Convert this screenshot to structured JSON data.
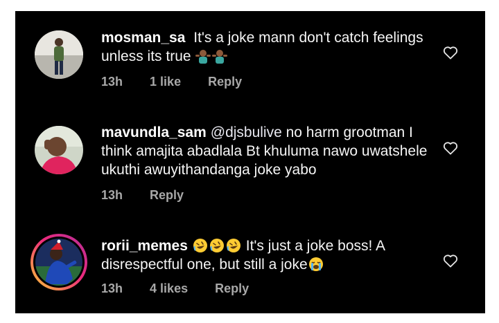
{
  "comments": [
    {
      "username": "mosman_sa",
      "text_1": " It's a joke mann don't catch feelings unless its true ",
      "time": "13h",
      "likes": "1 like",
      "reply": "Reply",
      "emoji": "person-shrugging-emoji"
    },
    {
      "username": "mavundla_sam",
      "mention": "@djsbulive",
      "text_1": " no harm grootman I think amajita abadlala Bt khuluma nawo uwatshele ukuthi awuyithandanga joke yabo",
      "time": "13h",
      "reply": "Reply"
    },
    {
      "username": "rorii_memes",
      "text_1": " It's just a joke boss! A disrespectful one, but still a joke",
      "time": "13h",
      "likes": "4 likes",
      "reply": "Reply",
      "emoji": "rolling-laughing-emoji"
    }
  ],
  "colors": {
    "background": "#000000",
    "text": "#f5f5f5",
    "meta": "#a8a8a8",
    "story_ring": "#ee2a7b"
  },
  "icons": {
    "like": "heart-outline-icon"
  }
}
